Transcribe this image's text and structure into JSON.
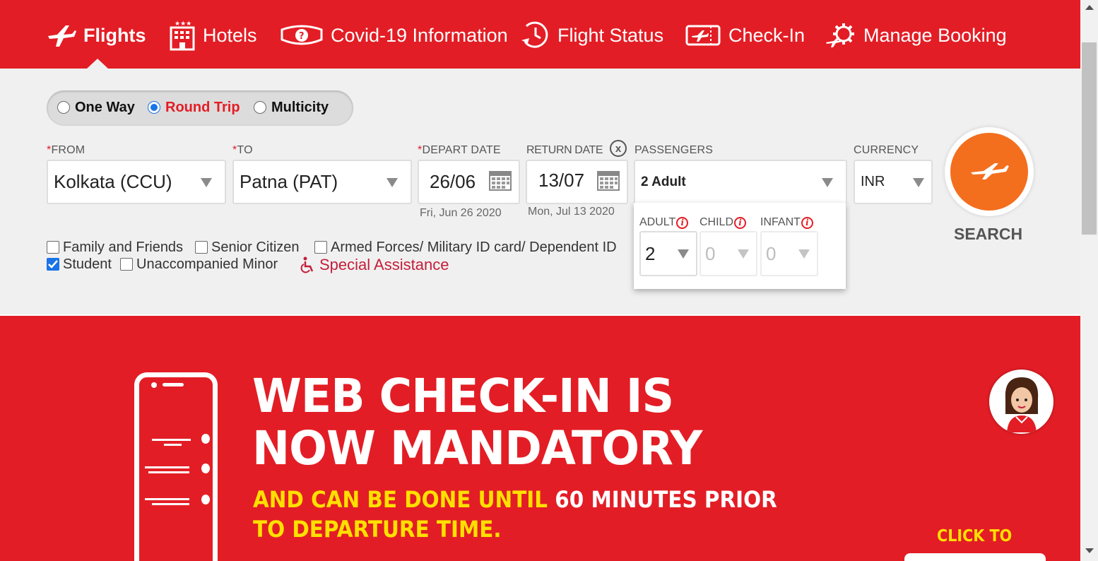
{
  "nav": {
    "items": [
      {
        "label": "Flights",
        "icon": "plane-icon",
        "active": true
      },
      {
        "label": "Hotels",
        "icon": "hotel-building-icon"
      },
      {
        "label": "Covid-19 Information",
        "icon": "mask-icon"
      },
      {
        "label": "Flight Status",
        "icon": "clock-plane-icon"
      },
      {
        "label": "Check-In",
        "icon": "ticket-icon"
      },
      {
        "label": "Manage Booking",
        "icon": "gear-plane-icon"
      }
    ]
  },
  "trip_type": {
    "options": [
      "One Way",
      "Round Trip",
      "Multicity"
    ],
    "selected": "Round Trip"
  },
  "search": {
    "from": {
      "label": "FROM",
      "value": "Kolkata (CCU)",
      "required": "*"
    },
    "to": {
      "label": "TO",
      "value": "Patna (PAT)",
      "required": "*"
    },
    "depart": {
      "label": "DEPART DATE",
      "value": "26/06",
      "sub": "Fri, Jun 26 2020",
      "required": "*"
    },
    "return": {
      "label": "RETURN DATE",
      "value": "13/07",
      "sub": "Mon, Jul 13 2020",
      "clear": "x"
    },
    "passengers": {
      "label": "PASSENGERS",
      "value": "2 Adult"
    },
    "currency": {
      "label": "CURRENCY",
      "value": "INR"
    },
    "search_label": "SEARCH"
  },
  "pax": {
    "adult": {
      "label": "ADULT",
      "value": "2"
    },
    "child": {
      "label": "CHILD",
      "value": "0"
    },
    "infant": {
      "label": "INFANT",
      "value": "0"
    },
    "info": "i"
  },
  "options": {
    "family": {
      "label": "Family and Friends",
      "checked": false
    },
    "senior": {
      "label": "Senior Citizen",
      "checked": false
    },
    "armed": {
      "label": "Armed Forces/ Military ID card/ Dependent ID",
      "checked": false
    },
    "student": {
      "label": "Student",
      "checked": true
    },
    "minor": {
      "label": "Unaccompanied Minor",
      "checked": false
    },
    "special": {
      "label": "Special Assistance",
      "icon": "wheelchair-icon"
    }
  },
  "banner": {
    "line1": "WEB CHECK-IN IS",
    "line2": "NOW MANDATORY",
    "sub1_yellow": "AND CAN BE DONE UNTIL ",
    "sub1_white": "60 MINUTES PRIOR",
    "sub2": "TO DEPARTURE TIME.",
    "cta": "CLICK TO"
  },
  "colors": {
    "brand_red": "#e31d25",
    "search_orange": "#f36f1e",
    "banner_yellow": "#ffe000",
    "assist_red": "#c41e3a"
  }
}
